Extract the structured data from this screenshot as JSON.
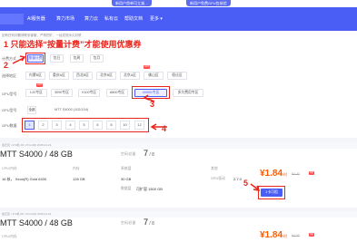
{
  "promo": {
    "left_text": "新用户首单可立减…",
    "right_text": "新用户免费GPU包体验"
  },
  "nav": {
    "logo_text": "AI服务器",
    "items": [
      "算力市场",
      "算力云",
      "私有云",
      "帮助文档"
    ],
    "more_label": "更多 ▾"
  },
  "filters": {
    "notice": "如有任何问题请联系客服，严禁挖矿，一经发现永久封禁",
    "billing_label": "计费方式",
    "billing_options": [
      "按量计费",
      "包日",
      "包周",
      "包月"
    ],
    "region_label": "选择地区",
    "region_options": [
      "内蒙B区",
      "重庆A区",
      "西北B区",
      "北京B区",
      "北京A区",
      "佛山区",
      "宿迁区"
    ],
    "region_hot": "HOT",
    "gpu_label": "GPU型号",
    "gpu_options": [
      "L20专区",
      "3090专区",
      "V100专区",
      "A800专区",
      "4090D专区",
      "多为费用专区"
    ],
    "gpu_hot": "HOT",
    "card_label": "GPU型号",
    "card_select": "全部",
    "card_model": "MTT S4000 (102/104)",
    "count_label": "GPU数量",
    "counts": [
      "1",
      "2",
      "3",
      "4",
      "5",
      "6",
      "8",
      "10",
      "12"
    ]
  },
  "annotations": {
    "n1_text": "1  只能选择“按量计费”才能使用优惠券",
    "n2": "2",
    "n3": "3",
    "n4": "4",
    "n5": "5"
  },
  "cards": [
    {
      "head": "宿迁区 / 172机 (ID: 27xxx00) 2025-01-01",
      "title": "MTT S4000 / 48 GB",
      "free_label": "空闲/总量",
      "free_value": "7",
      "total": "/ 8",
      "cpu_label": "CPU/内存",
      "cpu_value": "16 核， Xeon(R) Gold 6430",
      "mem_label": "内存",
      "mem_value": "128 GB",
      "disk_label": "系统盘",
      "disk_value": "30 GB",
      "data_label": "数据盘",
      "data_value": "可扩容 1500 GB",
      "extra_label": "其他",
      "gpu_driver_label": "GPU驱动",
      "gpu_driver_value": "2.7.0",
      "price": "¥1.84",
      "price_unit": "/时",
      "old_price": "¥2.30",
      "tag": "8折",
      "button": "1卡可租"
    },
    {
      "head": "宿迁区 / 172机 (ID: 27xxx01) 2025-01-01",
      "title": "MTT S4000 / 48 GB",
      "free_label": "空闲/总量",
      "free_value": "7",
      "total": "/ 8",
      "cpu_label": "CPU/内存",
      "price": "¥1.84",
      "price_unit": "/时",
      "old_price": "¥2.30",
      "tag": "8折"
    }
  ]
}
